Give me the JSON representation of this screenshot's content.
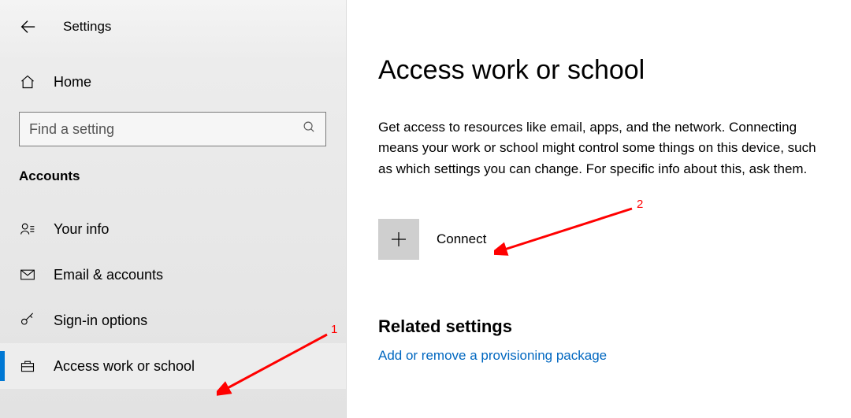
{
  "header": {
    "app_title": "Settings"
  },
  "sidebar": {
    "home_label": "Home",
    "search_placeholder": "Find a setting",
    "category": "Accounts",
    "items": [
      {
        "icon": "your-info-icon",
        "label": "Your info",
        "selected": false
      },
      {
        "icon": "email-icon",
        "label": "Email & accounts",
        "selected": false
      },
      {
        "icon": "key-icon",
        "label": "Sign-in options",
        "selected": false
      },
      {
        "icon": "briefcase-icon",
        "label": "Access work or school",
        "selected": true
      }
    ]
  },
  "main": {
    "title": "Access work or school",
    "description": "Get access to resources like email, apps, and the network. Connecting means your work or school might control some things on this device, such as which settings you can change. For specific info about this, ask them.",
    "connect_label": "Connect",
    "related_heading": "Related settings",
    "related_link": "Add or remove a provisioning package"
  },
  "annotations": {
    "one": "1",
    "two": "2"
  }
}
